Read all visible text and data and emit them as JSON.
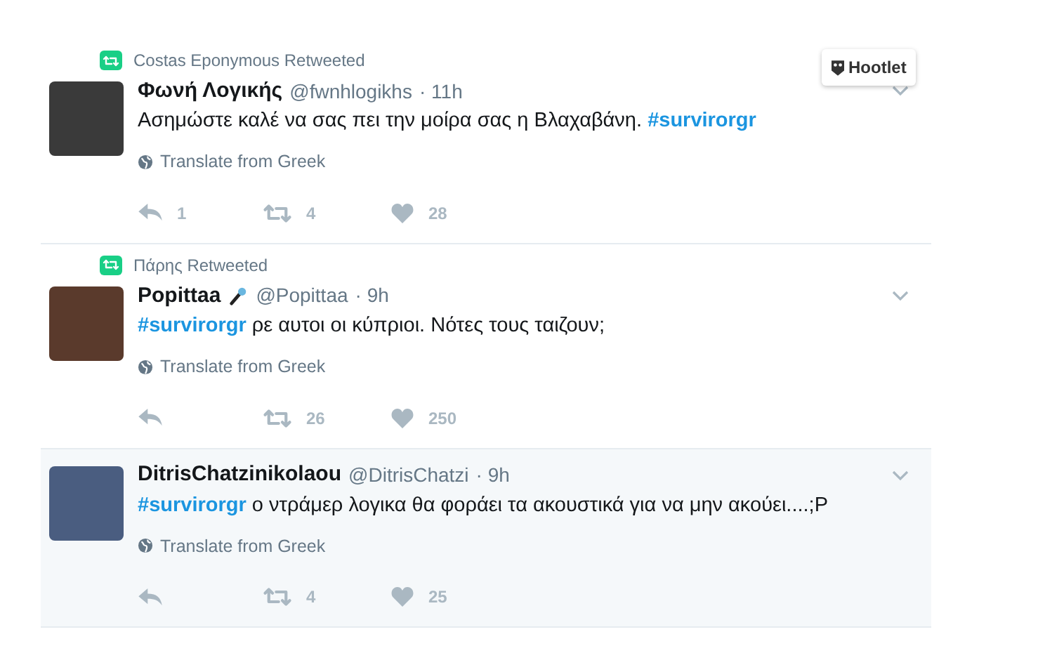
{
  "overlay": {
    "label": "Hootlet"
  },
  "tweets": [
    {
      "retweeted_by": "Costas Eponymous Retweeted",
      "name": "Φωνή Λογικής",
      "has_name_icon": false,
      "handle": "@fwnhlogikhs",
      "time": "· 11h",
      "highlighted": false,
      "body": [
        {
          "kind": "text",
          "text": "Ασημώστε καλέ να σας πει την μοίρα σας η Βλαχαβάνη."
        },
        {
          "kind": "hashtag",
          "text": "#survirorgr"
        }
      ],
      "translate": "Translate from Greek",
      "replies": "1",
      "retweets": "4",
      "likes": "28"
    },
    {
      "retweeted_by": "Πάρης Retweeted",
      "name": "Popittaa",
      "has_name_icon": true,
      "handle": "@Popittaa",
      "time": "· 9h",
      "highlighted": false,
      "body": [
        {
          "kind": "hashtag",
          "text": "#survirorgr"
        },
        {
          "kind": "text",
          "text": "ρε αυτοι οι κύπριοι. Νότες τους ταιζουν;"
        }
      ],
      "translate": "Translate from Greek",
      "retweets": "26",
      "likes": "250"
    },
    {
      "name": "DitrisChatzinikolaou",
      "has_name_icon": false,
      "handle": "@DitrisChatzi",
      "time": "· 9h",
      "highlighted": true,
      "body": [
        {
          "kind": "hashtag",
          "text": "#survirorgr"
        },
        {
          "kind": "text",
          "text": "ο ντράμερ λογικα θα φοράει τα ακουστικά για να μην ακούει....;P"
        }
      ],
      "translate": "Translate from Greek",
      "retweets": "4",
      "likes": "25"
    }
  ]
}
